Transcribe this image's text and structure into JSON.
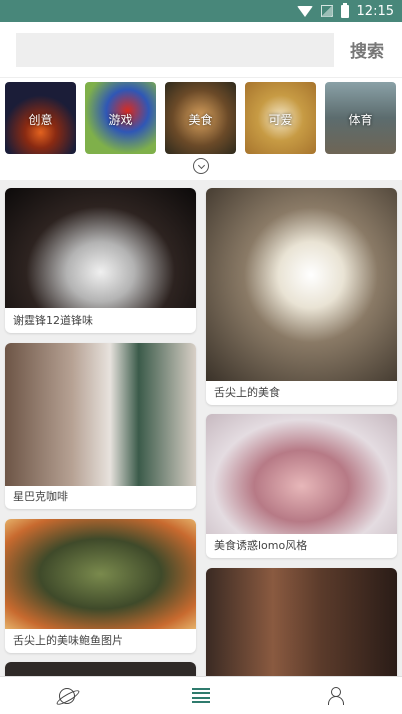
{
  "status_bar": {
    "time": "12:15"
  },
  "search": {
    "placeholder": "",
    "button_label": "搜索"
  },
  "categories": [
    {
      "label": "创意"
    },
    {
      "label": "游戏"
    },
    {
      "label": "美食"
    },
    {
      "label": "可爱"
    },
    {
      "label": "体育"
    }
  ],
  "feed": {
    "left_column": [
      {
        "caption": "谢霆锋12道锋味"
      },
      {
        "caption": "星巴克咖啡"
      },
      {
        "caption": "舌尖上的美味鲍鱼图片"
      },
      {
        "caption": ""
      }
    ],
    "right_column": [
      {
        "caption": "舌尖上的美食"
      },
      {
        "caption": "美食诱惑lomo风格"
      },
      {
        "caption": ""
      }
    ]
  },
  "tab_bar": {
    "tabs": [
      {
        "icon": "planet-icon"
      },
      {
        "icon": "list-icon",
        "active": true
      },
      {
        "icon": "user-icon"
      }
    ],
    "accent_color": "#2f7b6d"
  }
}
